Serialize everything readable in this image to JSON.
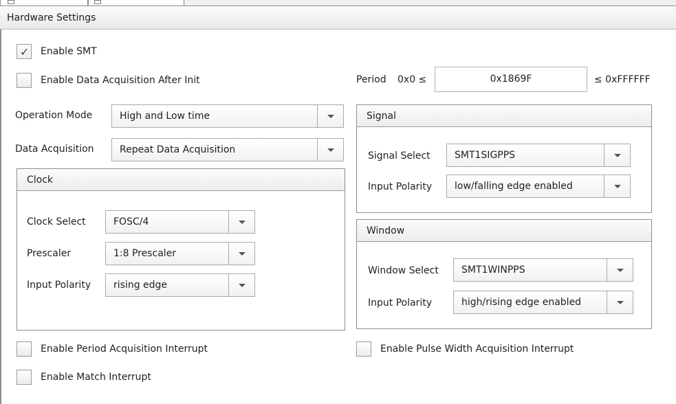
{
  "window": {
    "header_title": "Hardware Settings"
  },
  "top": {
    "enable_smt": {
      "label": "Enable SMT",
      "checked": true
    },
    "enable_data_acq_after_init": {
      "label": "Enable Data Acquisition After Init",
      "checked": false
    }
  },
  "period": {
    "label": "Period",
    "min": "0x0 ≤",
    "value": "0x1869F",
    "max": "≤ 0xFFFFFF"
  },
  "operation_mode": {
    "label": "Operation Mode",
    "value": "High and Low time"
  },
  "data_acquisition": {
    "label": "Data Acquisition",
    "value": "Repeat Data Acquisition"
  },
  "clock": {
    "title": "Clock",
    "select": {
      "label": "Clock Select",
      "value": "FOSC/4"
    },
    "prescaler": {
      "label": "Prescaler",
      "value": "1:8 Prescaler"
    },
    "polarity": {
      "label": "Input Polarity",
      "value": "rising edge"
    }
  },
  "signal": {
    "title": "Signal",
    "select": {
      "label": "Signal Select",
      "value": "SMT1SIGPPS"
    },
    "polarity": {
      "label": "Input Polarity",
      "value": "low/falling edge enabled"
    }
  },
  "window_group": {
    "title": "Window",
    "select": {
      "label": "Window Select",
      "value": "SMT1WINPPS"
    },
    "polarity": {
      "label": "Input Polarity",
      "value": "high/rising edge enabled"
    }
  },
  "interrupts": {
    "period_acq": {
      "label": "Enable Period Acquisition Interrupt",
      "checked": false
    },
    "pulse_width_acq": {
      "label": "Enable Pulse Width  Acquisition Interrupt",
      "checked": false
    },
    "match": {
      "label": "Enable Match Interrupt",
      "checked": false
    }
  },
  "icons": {
    "check": "✓",
    "dropdown": "chevron-down-icon"
  }
}
